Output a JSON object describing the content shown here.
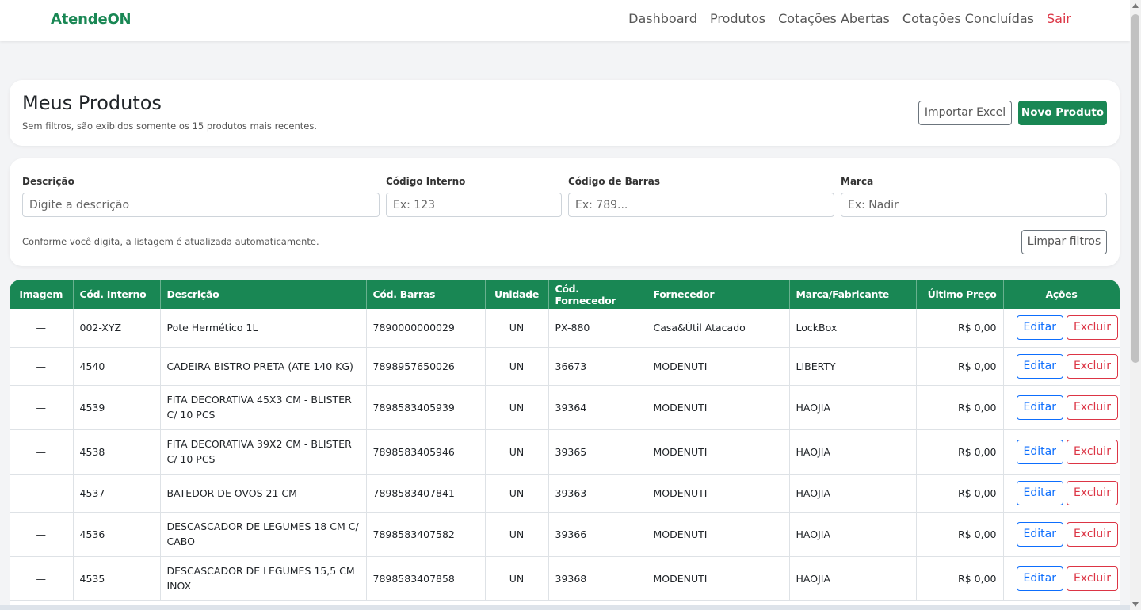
{
  "nav": {
    "brand": "AtendeON",
    "links": [
      "Dashboard",
      "Produtos",
      "Cotações Abertas",
      "Cotações Concluídas"
    ],
    "logout": "Sair"
  },
  "header": {
    "title": "Meus Produtos",
    "subtitle": "Sem filtros, são exibidos somente os 15 produtos mais recentes.",
    "import_label": "Importar Excel",
    "new_label": "Novo Produto"
  },
  "filters": {
    "descricao": {
      "label": "Descrição",
      "placeholder": "Digite a descrição",
      "value": ""
    },
    "codigo_interno": {
      "label": "Código Interno",
      "placeholder": "Ex: 123",
      "value": ""
    },
    "codigo_barras": {
      "label": "Código de Barras",
      "placeholder": "Ex: 789...",
      "value": ""
    },
    "marca": {
      "label": "Marca",
      "placeholder": "Ex: Nadir",
      "value": ""
    },
    "note": "Conforme você digita, a listagem é atualizada automaticamente.",
    "clear_label": "Limpar filtros"
  },
  "table": {
    "columns": [
      "Imagem",
      "Cód. Interno",
      "Descrição",
      "Cód. Barras",
      "Unidade",
      "Cód. Fornecedor",
      "Fornecedor",
      "Marca/Fabricante",
      "Último Preço",
      "Ações"
    ],
    "edit_label": "Editar",
    "delete_label": "Excluir",
    "rows": [
      {
        "imagem": "—",
        "codigo": "002-XYZ",
        "descricao": "Pote Hermético 1L",
        "barras": "7890000000029",
        "unidade": "UN",
        "cod_fornecedor": "PX-880",
        "fornecedor": "Casa&Útil Atacado",
        "marca": "LockBox",
        "preco": "R$ 0,00"
      },
      {
        "imagem": "—",
        "codigo": "4540",
        "descricao": "CADEIRA BISTRO PRETA (ATE 140 KG)",
        "barras": "7898957650026",
        "unidade": "UN",
        "cod_fornecedor": "36673",
        "fornecedor": "MODENUTI",
        "marca": "LIBERTY",
        "preco": "R$ 0,00"
      },
      {
        "imagem": "—",
        "codigo": "4539",
        "descricao": "FITA DECORATIVA 45X3 CM - BLISTER C/ 10 PCS",
        "barras": "7898583405939",
        "unidade": "UN",
        "cod_fornecedor": "39364",
        "fornecedor": "MODENUTI",
        "marca": "HAOJIA",
        "preco": "R$ 0,00"
      },
      {
        "imagem": "—",
        "codigo": "4538",
        "descricao": "FITA DECORATIVA 39X2 CM - BLISTER C/ 10 PCS",
        "barras": "7898583405946",
        "unidade": "UN",
        "cod_fornecedor": "39365",
        "fornecedor": "MODENUTI",
        "marca": "HAOJIA",
        "preco": "R$ 0,00"
      },
      {
        "imagem": "—",
        "codigo": "4537",
        "descricao": "BATEDOR DE OVOS 21 CM",
        "barras": "7898583407841",
        "unidade": "UN",
        "cod_fornecedor": "39363",
        "fornecedor": "MODENUTI",
        "marca": "HAOJIA",
        "preco": "R$ 0,00"
      },
      {
        "imagem": "—",
        "codigo": "4536",
        "descricao": "DESCASCADOR DE LEGUMES 18 CM C/ CABO",
        "barras": "7898583407582",
        "unidade": "UN",
        "cod_fornecedor": "39366",
        "fornecedor": "MODENUTI",
        "marca": "HAOJIA",
        "preco": "R$ 0,00"
      },
      {
        "imagem": "—",
        "codigo": "4535",
        "descricao": "DESCASCADOR DE LEGUMES 15,5 CM INOX",
        "barras": "7898583407858",
        "unidade": "UN",
        "cod_fornecedor": "39368",
        "fornecedor": "MODENUTI",
        "marca": "HAOJIA",
        "preco": "R$ 0,00"
      }
    ]
  },
  "colors": {
    "brand": "#198754",
    "danger": "#dc3545",
    "primary": "#0d6efd"
  }
}
